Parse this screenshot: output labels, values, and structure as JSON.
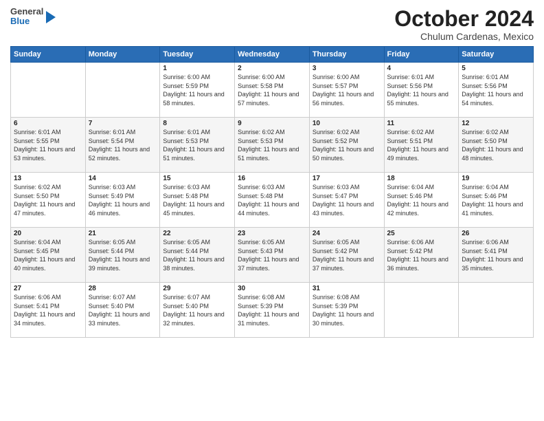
{
  "header": {
    "logo": {
      "line1": "General",
      "line2": "Blue"
    },
    "title": "October 2024",
    "subtitle": "Chulum Cardenas, Mexico"
  },
  "days_of_week": [
    "Sunday",
    "Monday",
    "Tuesday",
    "Wednesday",
    "Thursday",
    "Friday",
    "Saturday"
  ],
  "weeks": [
    [
      {
        "day": "",
        "info": ""
      },
      {
        "day": "",
        "info": ""
      },
      {
        "day": "1",
        "info": "Sunrise: 6:00 AM\nSunset: 5:59 PM\nDaylight: 11 hours and 58 minutes."
      },
      {
        "day": "2",
        "info": "Sunrise: 6:00 AM\nSunset: 5:58 PM\nDaylight: 11 hours and 57 minutes."
      },
      {
        "day": "3",
        "info": "Sunrise: 6:00 AM\nSunset: 5:57 PM\nDaylight: 11 hours and 56 minutes."
      },
      {
        "day": "4",
        "info": "Sunrise: 6:01 AM\nSunset: 5:56 PM\nDaylight: 11 hours and 55 minutes."
      },
      {
        "day": "5",
        "info": "Sunrise: 6:01 AM\nSunset: 5:56 PM\nDaylight: 11 hours and 54 minutes."
      }
    ],
    [
      {
        "day": "6",
        "info": "Sunrise: 6:01 AM\nSunset: 5:55 PM\nDaylight: 11 hours and 53 minutes."
      },
      {
        "day": "7",
        "info": "Sunrise: 6:01 AM\nSunset: 5:54 PM\nDaylight: 11 hours and 52 minutes."
      },
      {
        "day": "8",
        "info": "Sunrise: 6:01 AM\nSunset: 5:53 PM\nDaylight: 11 hours and 51 minutes."
      },
      {
        "day": "9",
        "info": "Sunrise: 6:02 AM\nSunset: 5:53 PM\nDaylight: 11 hours and 51 minutes."
      },
      {
        "day": "10",
        "info": "Sunrise: 6:02 AM\nSunset: 5:52 PM\nDaylight: 11 hours and 50 minutes."
      },
      {
        "day": "11",
        "info": "Sunrise: 6:02 AM\nSunset: 5:51 PM\nDaylight: 11 hours and 49 minutes."
      },
      {
        "day": "12",
        "info": "Sunrise: 6:02 AM\nSunset: 5:50 PM\nDaylight: 11 hours and 48 minutes."
      }
    ],
    [
      {
        "day": "13",
        "info": "Sunrise: 6:02 AM\nSunset: 5:50 PM\nDaylight: 11 hours and 47 minutes."
      },
      {
        "day": "14",
        "info": "Sunrise: 6:03 AM\nSunset: 5:49 PM\nDaylight: 11 hours and 46 minutes."
      },
      {
        "day": "15",
        "info": "Sunrise: 6:03 AM\nSunset: 5:48 PM\nDaylight: 11 hours and 45 minutes."
      },
      {
        "day": "16",
        "info": "Sunrise: 6:03 AM\nSunset: 5:48 PM\nDaylight: 11 hours and 44 minutes."
      },
      {
        "day": "17",
        "info": "Sunrise: 6:03 AM\nSunset: 5:47 PM\nDaylight: 11 hours and 43 minutes."
      },
      {
        "day": "18",
        "info": "Sunrise: 6:04 AM\nSunset: 5:46 PM\nDaylight: 11 hours and 42 minutes."
      },
      {
        "day": "19",
        "info": "Sunrise: 6:04 AM\nSunset: 5:46 PM\nDaylight: 11 hours and 41 minutes."
      }
    ],
    [
      {
        "day": "20",
        "info": "Sunrise: 6:04 AM\nSunset: 5:45 PM\nDaylight: 11 hours and 40 minutes."
      },
      {
        "day": "21",
        "info": "Sunrise: 6:05 AM\nSunset: 5:44 PM\nDaylight: 11 hours and 39 minutes."
      },
      {
        "day": "22",
        "info": "Sunrise: 6:05 AM\nSunset: 5:44 PM\nDaylight: 11 hours and 38 minutes."
      },
      {
        "day": "23",
        "info": "Sunrise: 6:05 AM\nSunset: 5:43 PM\nDaylight: 11 hours and 37 minutes."
      },
      {
        "day": "24",
        "info": "Sunrise: 6:05 AM\nSunset: 5:42 PM\nDaylight: 11 hours and 37 minutes."
      },
      {
        "day": "25",
        "info": "Sunrise: 6:06 AM\nSunset: 5:42 PM\nDaylight: 11 hours and 36 minutes."
      },
      {
        "day": "26",
        "info": "Sunrise: 6:06 AM\nSunset: 5:41 PM\nDaylight: 11 hours and 35 minutes."
      }
    ],
    [
      {
        "day": "27",
        "info": "Sunrise: 6:06 AM\nSunset: 5:41 PM\nDaylight: 11 hours and 34 minutes."
      },
      {
        "day": "28",
        "info": "Sunrise: 6:07 AM\nSunset: 5:40 PM\nDaylight: 11 hours and 33 minutes."
      },
      {
        "day": "29",
        "info": "Sunrise: 6:07 AM\nSunset: 5:40 PM\nDaylight: 11 hours and 32 minutes."
      },
      {
        "day": "30",
        "info": "Sunrise: 6:08 AM\nSunset: 5:39 PM\nDaylight: 11 hours and 31 minutes."
      },
      {
        "day": "31",
        "info": "Sunrise: 6:08 AM\nSunset: 5:39 PM\nDaylight: 11 hours and 30 minutes."
      },
      {
        "day": "",
        "info": ""
      },
      {
        "day": "",
        "info": ""
      }
    ]
  ]
}
